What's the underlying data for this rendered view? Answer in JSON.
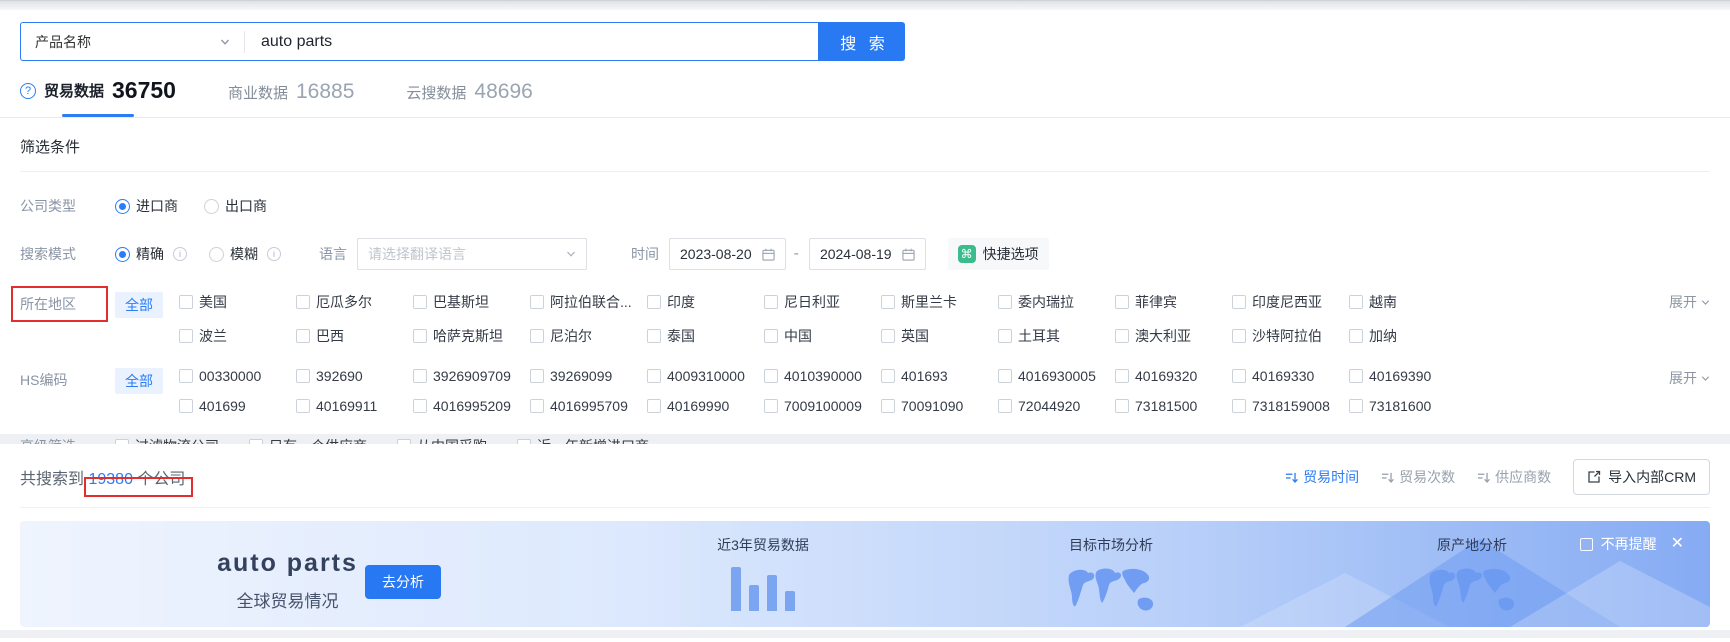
{
  "search": {
    "category_label": "产品名称",
    "query": "auto parts",
    "button_label": "搜 索"
  },
  "tabs": [
    {
      "label": "贸易数据",
      "count": "36750"
    },
    {
      "label": "商业数据",
      "count": "16885"
    },
    {
      "label": "云搜数据",
      "count": "48696"
    }
  ],
  "filter": {
    "section_title": "筛选条件",
    "company_type": {
      "label": "公司类型",
      "importer": "进口商",
      "exporter": "出口商",
      "selected": "进口商"
    },
    "search_mode": {
      "label": "搜索模式",
      "exact": "精确",
      "fuzzy": "模糊",
      "selected": "精确"
    },
    "language": {
      "label": "语言",
      "placeholder": "请选择翻译语言"
    },
    "time": {
      "label": "时间",
      "start": "2023-08-20",
      "separator": "-",
      "end": "2024-08-19"
    },
    "quick_label": "快捷选项",
    "all_label": "全部",
    "expand_label": "展开",
    "region": {
      "label": "所在地区",
      "row1": [
        "美国",
        "厄瓜多尔",
        "巴基斯坦",
        "阿拉伯联合...",
        "印度",
        "尼日利亚",
        "斯里兰卡",
        "委内瑞拉",
        "菲律宾",
        "印度尼西亚",
        "越南"
      ],
      "row2": [
        "波兰",
        "巴西",
        "哈萨克斯坦",
        "尼泊尔",
        "泰国",
        "中国",
        "英国",
        "土耳其",
        "澳大利亚",
        "沙特阿拉伯",
        "加纳"
      ]
    },
    "hs_code": {
      "label": "HS编码",
      "row1": [
        "00330000",
        "392690",
        "3926909709",
        "39269099",
        "4009310000",
        "4010390000",
        "401693",
        "4016930005",
        "40169320",
        "40169330",
        "40169390"
      ],
      "row2": [
        "401699",
        "40169911",
        "4016995209",
        "4016995709",
        "40169990",
        "7009100009",
        "70091090",
        "72044920",
        "73181500",
        "7318159008",
        "73181600"
      ]
    },
    "advanced": {
      "label": "高级筛选",
      "options": [
        "过滤物流公司",
        "只有一个供应商",
        "从中国采购",
        "近一年新增进口商"
      ]
    }
  },
  "results": {
    "prefix": "共搜索到",
    "count": "19380",
    "suffix": "个公司",
    "sorts": [
      "贸易时间",
      "贸易次数",
      "供应商数"
    ],
    "active_sort": "贸易时间",
    "crm_button": "导入内部CRM"
  },
  "banner": {
    "keyword": "auto parts",
    "subtitle": "全球贸易情况",
    "analyze_label": "去分析",
    "feature1": "近3年贸易数据",
    "feature2": "目标市场分析",
    "feature3": "原产地分析",
    "dismiss_label": "不再提醒",
    "close_glyph": "✕"
  },
  "colors": {
    "accent": "#2b7cf6",
    "quick_green": "#3cbc8d",
    "annotation_red": "#e12e2e"
  }
}
